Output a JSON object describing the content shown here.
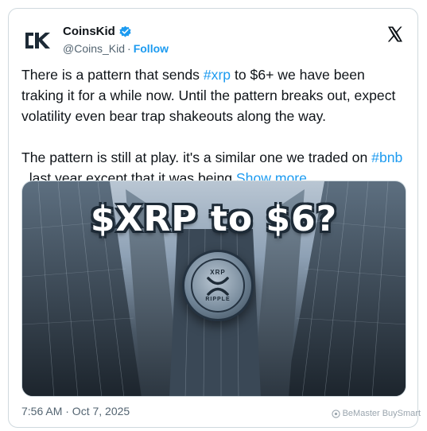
{
  "account": {
    "display_name": "CoinsKid",
    "handle": "@Coins_Kid",
    "separator": "·",
    "follow_label": "Follow",
    "logo_text": "CK"
  },
  "tweet": {
    "p1_pre": "There is a pattern that sends ",
    "p1_hashtag": "#xrp",
    "p1_post": " to $6+ we have been traking it for a while now. Until the pattern breaks out, expect volatility even bear trap shakeouts along the way.",
    "p2_pre": "The pattern is still at play. it's a similar one we traded on ",
    "p2_hashtag": "#bnb",
    "p2_post": "  last year except that it was being ",
    "show_more": "Show more"
  },
  "media": {
    "title": "$XRP to $6?",
    "coin_top": "XRP",
    "coin_bottom": "RIPPLE"
  },
  "timestamp": "7:56 AM · Oct 7, 2025",
  "watermark": "BeMaster BuySmart",
  "colors": {
    "accent": "#1d9bf0",
    "text": "#0f1419",
    "secondary": "#536471",
    "border": "#cfd9de"
  }
}
